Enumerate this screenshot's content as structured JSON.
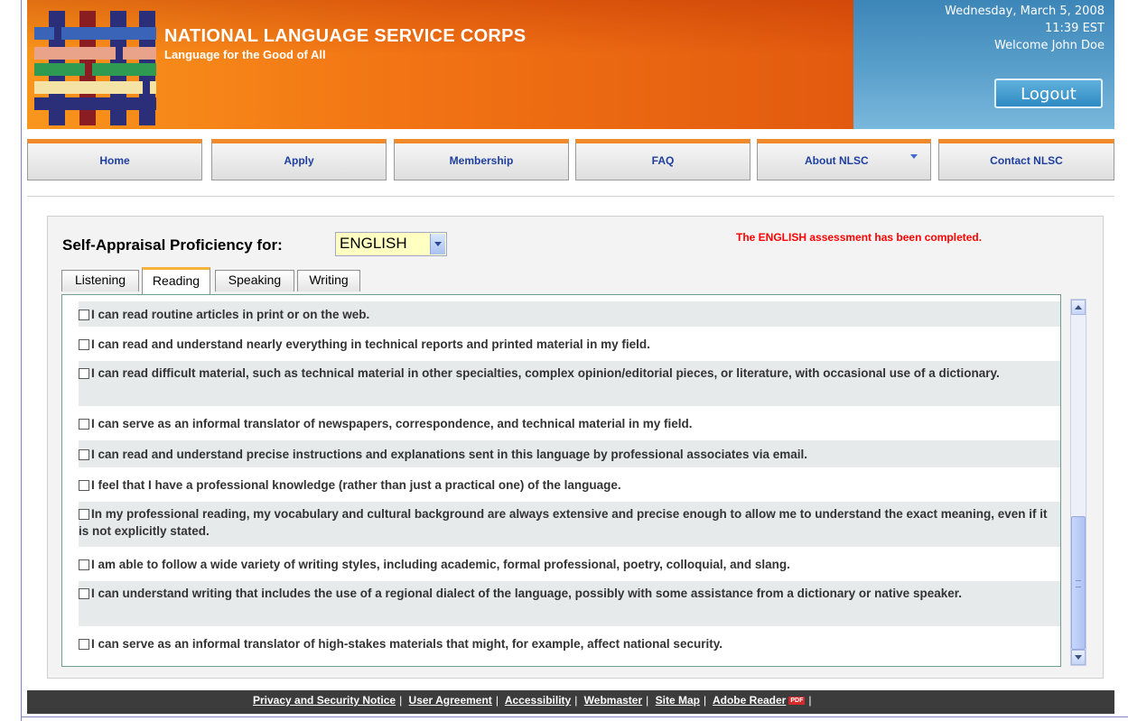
{
  "header": {
    "title": "NATIONAL LANGUAGE SERVICE CORPS",
    "tagline": "Language for the Good of All",
    "date": "Wednesday, March 5, 2008",
    "time": "11:39 EST",
    "welcome": "Welcome John Doe",
    "logout_label": "Logout",
    "colors": {
      "orange": "#f27414",
      "blue": "#4f97c6"
    }
  },
  "nav": [
    {
      "label": "Home"
    },
    {
      "label": "Apply"
    },
    {
      "label": "Membership"
    },
    {
      "label": "FAQ"
    },
    {
      "label": "About NLSC",
      "has_dropdown": true
    },
    {
      "label": "Contact NLSC"
    }
  ],
  "assessment": {
    "label": "Self-Appraisal Proficiency for:",
    "language": "ENGLISH",
    "status": "The ENGLISH assessment has been completed.",
    "status_color": "#ff0000",
    "tabs": [
      "Listening",
      "Reading",
      "Speaking",
      "Writing"
    ],
    "active_tab": "Reading",
    "items": [
      "I can read routine articles in print or on the web.",
      "I can read and understand nearly everything in technical reports and printed material in my field.",
      "I can read difficult material, such as technical material in other specialties, complex opinion/editorial pieces, or literature, with occasional use of a dictionary.",
      "I can serve as an informal translator of newspapers, correspondence, and technical material in my field.",
      "I can read and understand precise instructions and explanations sent in this language by professional associates via email.",
      "I feel that I have a professional knowledge (rather than just a practical one) of the language.",
      "In my professional reading, my vocabulary and cultural background are always extensive and precise enough to allow me to understand the exact meaning, even if it is not explicitly stated.",
      "I am able to follow a wide variety of writing styles, including academic, formal professional, poetry, colloquial, and slang.",
      "I can understand writing that includes the use of a regional dialect of the language, possibly with some assistance from a dictionary or native speaker.",
      "I can serve as an informal translator of high-stakes materials that might, for example, affect national security."
    ]
  },
  "footer": {
    "links": [
      "Privacy and Security Notice",
      "User Agreement",
      "Accessibility",
      "Webmaster",
      "Site Map",
      "Adobe Reader"
    ],
    "pdf_badge": "PDF"
  }
}
